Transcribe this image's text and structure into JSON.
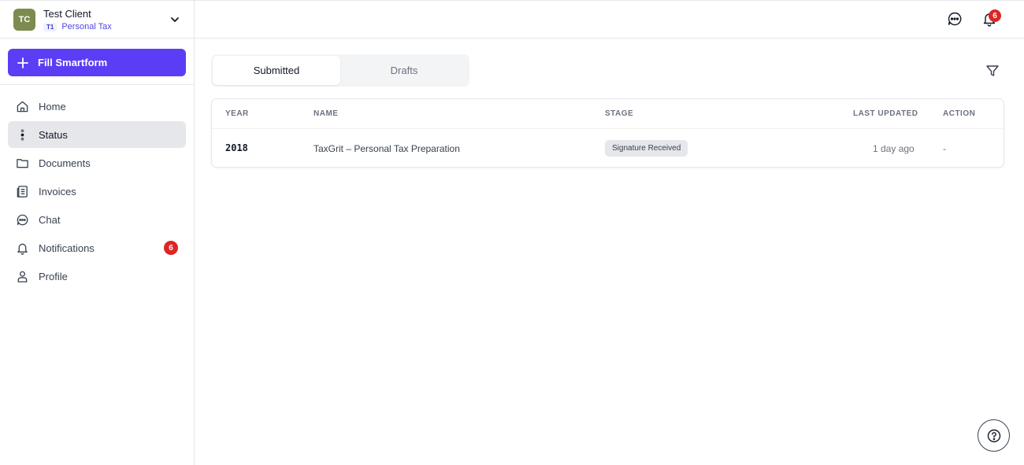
{
  "client": {
    "initials": "TC",
    "name": "Test Client",
    "tax_code": "T1",
    "tax_type": "Personal Tax"
  },
  "actions": {
    "fill_smartform": "Fill Smartform"
  },
  "nav": [
    {
      "label": "Home",
      "icon": "home-icon"
    },
    {
      "label": "Status",
      "icon": "status-icon"
    },
    {
      "label": "Documents",
      "icon": "folder-icon"
    },
    {
      "label": "Invoices",
      "icon": "invoice-icon"
    },
    {
      "label": "Chat",
      "icon": "chat-icon"
    },
    {
      "label": "Notifications",
      "icon": "bell-icon",
      "badge": "6"
    },
    {
      "label": "Profile",
      "icon": "user-icon"
    }
  ],
  "header": {
    "notification_count": "6"
  },
  "tabs": [
    {
      "label": "Submitted"
    },
    {
      "label": "Drafts"
    }
  ],
  "table": {
    "columns": [
      "YEAR",
      "NAME",
      "STAGE",
      "LAST UPDATED",
      "ACTION"
    ],
    "rows": [
      {
        "year": "2018",
        "name": "TaxGrit – Personal Tax Preparation",
        "stage": "Signature Received",
        "last_updated": "1 day ago",
        "action": "-"
      }
    ]
  },
  "colors": {
    "accent": "#5b3df5",
    "badge": "#dc2626",
    "avatar": "#7c8b4e"
  }
}
